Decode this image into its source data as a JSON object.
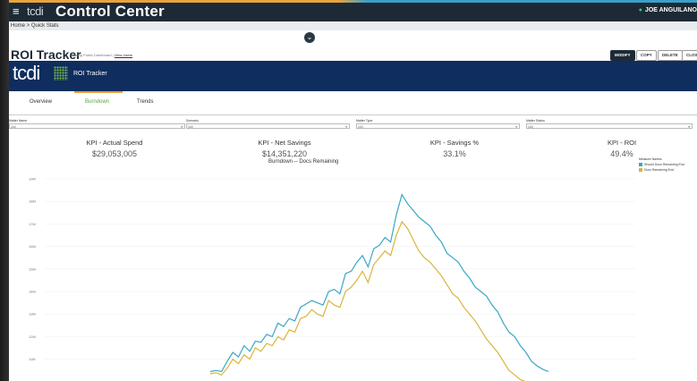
{
  "app": {
    "brand": "tcdi",
    "title": "Control Center",
    "user": "JOE ANGUILANO"
  },
  "breadcrumb": {
    "text": "Home > Quick Stats"
  },
  "page": {
    "title": "ROI Tracker",
    "viewing_prefix": "Viewing Public Dashboard |",
    "viewing_link": "View Users"
  },
  "actions": {
    "modify": "MODIFY",
    "copy": "COPY",
    "delete": "DELETE",
    "close": "CLOSE"
  },
  "hero": {
    "logo": "tcdi",
    "subtitle": "ROI Tracker"
  },
  "tabs": [
    {
      "label": "Overview"
    },
    {
      "label": "Burndown"
    },
    {
      "label": "Trends"
    }
  ],
  "filters": [
    {
      "label": "Matter Name",
      "value": "(All)"
    },
    {
      "label": "Scenario",
      "value": "(All)"
    },
    {
      "label": "Matter Type",
      "value": "(All)"
    },
    {
      "label": "Matter Status",
      "value": "(All)"
    }
  ],
  "kpis": [
    {
      "label": "KPI - Actual Spend",
      "value": "$29,053,005"
    },
    {
      "label": "KPI - Net Savings",
      "value": "$14,351,220"
    },
    {
      "label": "KPI - Savings %",
      "value": "33.1%"
    },
    {
      "label": "KPI - ROI",
      "value": "49.4%"
    }
  ],
  "colors": {
    "teal": "#3aa7c4",
    "gold": "#d9b43a",
    "navy": "#0f2d5e",
    "accent_orange": "#e8a33b"
  },
  "chart_data": {
    "type": "line",
    "title": "Burndown -- Docs Remaining",
    "legend_title": "Measure Names",
    "y_ticks": [
      "19M",
      "18M",
      "17M",
      "16M",
      "15M",
      "14M",
      "13M",
      "12M",
      "11M"
    ],
    "series": [
      {
        "name": "Should Docs Remaining End",
        "color": "#3aa7c4",
        "values": [
          10.45,
          10.5,
          10.45,
          10.9,
          11.3,
          11.1,
          11.6,
          11.35,
          11.8,
          11.75,
          12.1,
          12.0,
          12.6,
          12.45,
          12.8,
          12.7,
          13.3,
          13.45,
          13.6,
          13.5,
          13.4,
          14.0,
          14.1,
          13.9,
          14.8,
          14.9,
          15.3,
          15.6,
          15.1,
          15.9,
          16.05,
          16.4,
          16.2,
          17.4,
          18.3,
          17.9,
          17.6,
          17.3,
          17.1,
          16.9,
          16.5,
          16.2,
          15.7,
          15.5,
          15.3,
          14.9,
          14.6,
          14.2,
          14.0,
          13.8,
          13.4,
          13.1,
          12.6,
          12.2,
          12.0,
          11.6,
          11.3,
          10.9,
          10.7,
          10.55,
          10.45
        ]
      },
      {
        "name": "Docs Remaining End",
        "color": "#d9b43a",
        "values": [
          10.35,
          10.4,
          10.3,
          10.6,
          11.0,
          10.8,
          11.2,
          11.0,
          11.5,
          11.35,
          11.7,
          11.6,
          12.0,
          11.85,
          12.3,
          12.2,
          12.8,
          12.9,
          13.2,
          13.0,
          12.9,
          13.6,
          13.4,
          13.3,
          14.0,
          14.2,
          14.5,
          14.9,
          14.4,
          15.2,
          15.5,
          15.8,
          15.6,
          16.5,
          17.1,
          16.8,
          16.3,
          15.8,
          15.5,
          15.3,
          15.0,
          14.7,
          14.3,
          13.9,
          13.7,
          13.3,
          13.0,
          12.7,
          12.3,
          11.9,
          11.6,
          11.3,
          10.9,
          10.5,
          10.3,
          10.1,
          10.0,
          9.9,
          9.8,
          9.7,
          9.6
        ]
      }
    ],
    "ylim": [
      10.4,
      19.2
    ],
    "grid": true,
    "legend_position": "top-right"
  }
}
